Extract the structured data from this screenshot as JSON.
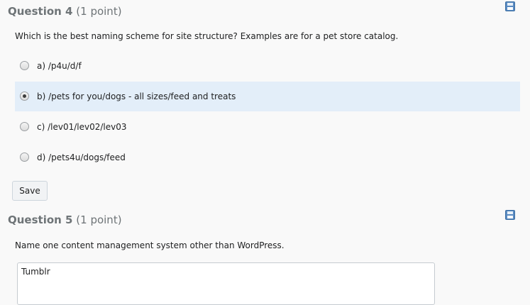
{
  "q4": {
    "title": "Question 4",
    "points": "(1 point)",
    "text": "Which is the best naming scheme for site structure? Examples are for a pet store catalog.",
    "options": [
      {
        "label": "a)  /p4u/d/f",
        "selected": false
      },
      {
        "label": "b)  /pets for you/dogs - all sizes/feed and treats",
        "selected": true
      },
      {
        "label": "c)  /lev01/lev02/lev03",
        "selected": false
      },
      {
        "label": "d)  /pets4u/dogs/feed",
        "selected": false
      }
    ],
    "save_label": "Save"
  },
  "q5": {
    "title": "Question 5",
    "points": "(1 point)",
    "text": "Name one content management system other than WordPress.",
    "answer": "Tumblr"
  },
  "colors": {
    "selected_bg": "#e3eef9",
    "save_icon": "#5a8bc2",
    "header_text": "#6e7477"
  },
  "icons": {
    "save": "floppy-disk-icon"
  }
}
